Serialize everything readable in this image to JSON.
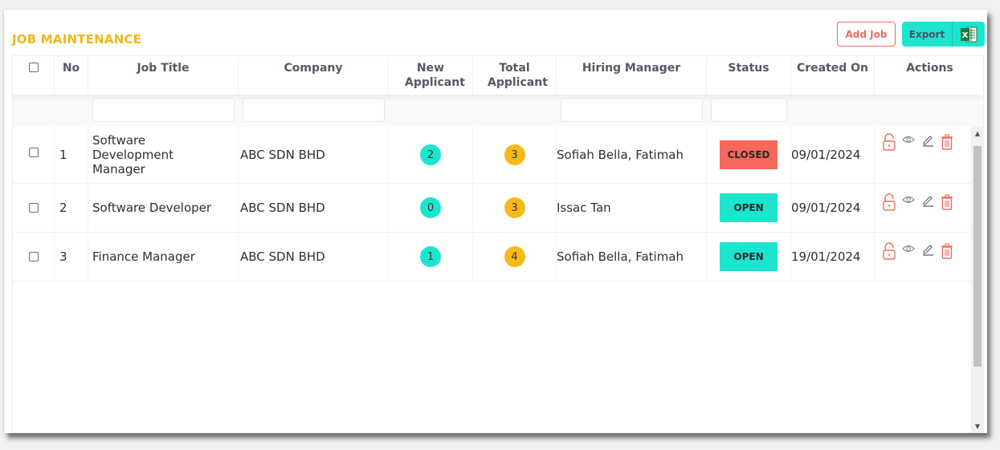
{
  "page": {
    "title": "JOB MAINTENANCE"
  },
  "toolbar": {
    "add_job_label": "Add Job",
    "export_label": "Export",
    "export_icon": "excel-icon"
  },
  "colors": {
    "title": "#f2b61c",
    "accent_teal": "#1de4cf",
    "accent_orange": "#f9b81a",
    "danger": "#f06b62",
    "closed_bg": "#f6675c",
    "open_bg": "#1de4cf"
  },
  "table": {
    "columns": {
      "select_all": "",
      "no": "No",
      "job_title": "Job Title",
      "company": "Company",
      "new_applicant": "New Applicant",
      "total_applicant": "Total Applicant",
      "hiring_manager": "Hiring Manager",
      "status": "Status",
      "created_on": "Created On",
      "actions": "Actions"
    },
    "filters": {
      "job_title": "",
      "company": "",
      "hiring_manager": "",
      "status": ""
    },
    "rows": [
      {
        "no": "1",
        "job_title": "Software Development Manager",
        "company": "ABC SDN BHD",
        "new_applicant": "2",
        "total_applicant": "3",
        "hiring_manager": "Sofiah Bella, Fatimah",
        "status": "CLOSED",
        "created_on": "09/01/2024"
      },
      {
        "no": "2",
        "job_title": "Software Developer",
        "company": "ABC SDN BHD",
        "new_applicant": "0",
        "total_applicant": "3",
        "hiring_manager": "Issac Tan",
        "status": "OPEN",
        "created_on": "09/01/2024"
      },
      {
        "no": "3",
        "job_title": "Finance Manager",
        "company": "ABC SDN BHD",
        "new_applicant": "1",
        "total_applicant": "4",
        "hiring_manager": "Sofiah Bella, Fatimah",
        "status": "OPEN",
        "created_on": "19/01/2024"
      }
    ],
    "row_actions": [
      "lock-icon",
      "view-icon",
      "edit-icon",
      "delete-icon"
    ]
  }
}
